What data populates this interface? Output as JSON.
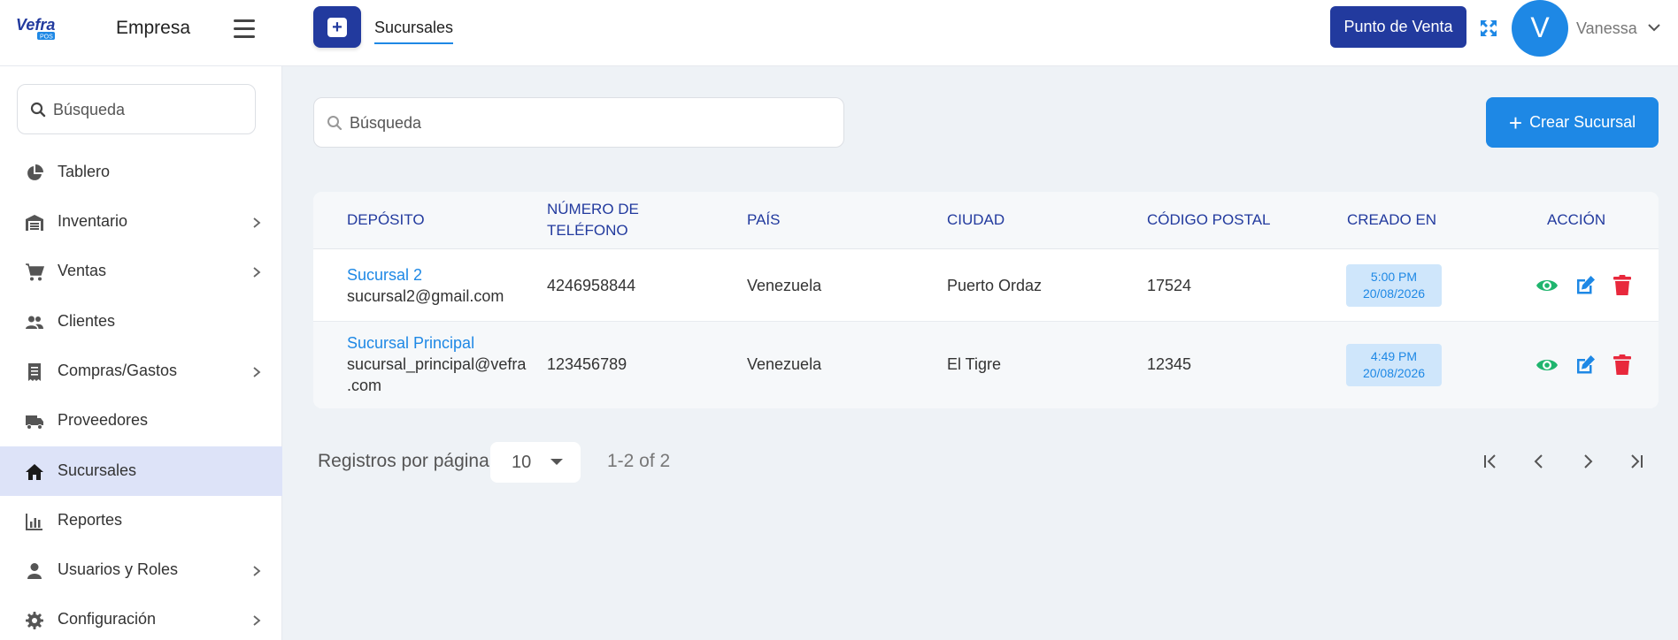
{
  "header": {
    "logo_text": "Vefra",
    "logo_sub": "POS",
    "company": "Empresa",
    "active_tab": "Sucursales",
    "pos_button": "Punto de Venta",
    "avatar_initial": "V",
    "user_name": "Vanessa"
  },
  "sidebar": {
    "search_placeholder": "Búsqueda",
    "items": [
      {
        "label": "Tablero",
        "icon": "chart-pie-icon",
        "has_submenu": false
      },
      {
        "label": "Inventario",
        "icon": "warehouse-icon",
        "has_submenu": true
      },
      {
        "label": "Ventas",
        "icon": "cart-icon",
        "has_submenu": true
      },
      {
        "label": "Clientes",
        "icon": "users-icon",
        "has_submenu": false
      },
      {
        "label": "Compras/Gastos",
        "icon": "receipt-icon",
        "has_submenu": true
      },
      {
        "label": "Proveedores",
        "icon": "truck-icon",
        "has_submenu": false
      },
      {
        "label": "Sucursales",
        "icon": "home-icon",
        "has_submenu": false,
        "active": true
      },
      {
        "label": "Reportes",
        "icon": "bar-chart-icon",
        "has_submenu": false
      },
      {
        "label": "Usuarios y Roles",
        "icon": "user-icon",
        "has_submenu": true
      },
      {
        "label": "Configuración",
        "icon": "gear-icon",
        "has_submenu": true
      }
    ]
  },
  "main": {
    "search_placeholder": "Búsqueda",
    "create_button": "Crear Sucursal"
  },
  "table": {
    "headers": {
      "deposito": "DEPÓSITO",
      "telefono_1": "NÚMERO DE",
      "telefono_2": "TELÉFONO",
      "pais": "PAÍS",
      "ciudad": "CIUDAD",
      "codigo_postal": "CÓDIGO POSTAL",
      "creado_en": "CREADO EN",
      "accion": "ACCIÓN"
    },
    "rows": [
      {
        "name": "Sucursal 2",
        "email": "sucursal2@gmail.com",
        "email_2": "",
        "phone": "4246958844",
        "country": "Venezuela",
        "city": "Puerto Ordaz",
        "postal": "17524",
        "time": "5:00 PM",
        "date": "20/08/2026"
      },
      {
        "name": "Sucursal Principal",
        "email": "sucursal_principal@vefra",
        "email_2": ".com",
        "phone": "123456789",
        "country": "Venezuela",
        "city": "El Tigre",
        "postal": "12345",
        "time": "4:49 PM",
        "date": "20/08/2026"
      }
    ]
  },
  "pagination": {
    "label": "Registros por página",
    "per_page": "10",
    "range": "1-2 of 2"
  },
  "colors": {
    "primary": "#1e88e5",
    "dark_primary": "#223a9e",
    "view": "#1fb56e",
    "delete": "#e8283c",
    "active_bg": "#dde3f8"
  }
}
